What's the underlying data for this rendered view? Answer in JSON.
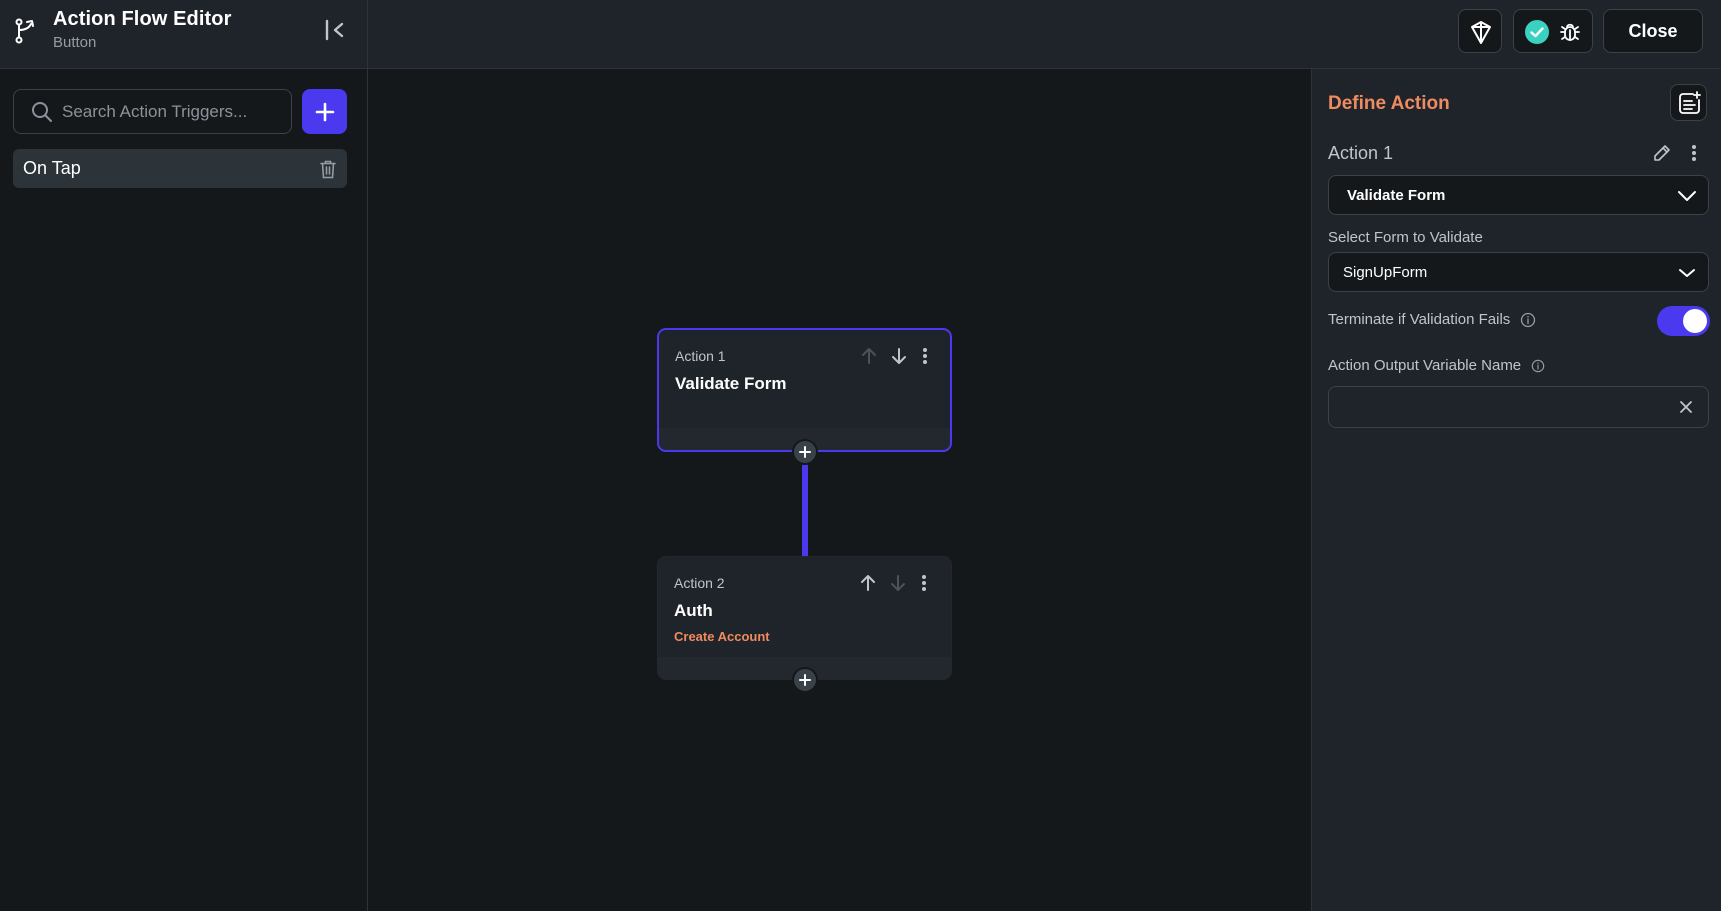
{
  "header": {
    "title": "Action Flow Editor",
    "subtitle": "Button",
    "close_label": "Close"
  },
  "sidebar": {
    "search_placeholder": "Search Action Triggers...",
    "triggers": [
      {
        "label": "On Tap"
      }
    ]
  },
  "canvas": {
    "nodes": [
      {
        "label": "Action 1",
        "title": "Validate Form",
        "subtitle": ""
      },
      {
        "label": "Action 2",
        "title": "Auth",
        "subtitle": "Create Account"
      }
    ]
  },
  "panel": {
    "title": "Define Action",
    "action_name": "Action 1",
    "action_type": "Validate Form",
    "form_label": "Select Form to Validate",
    "form_value": "SignUpForm",
    "terminate_label": "Terminate if Validation Fails",
    "terminate_enabled": true,
    "output_label": "Action Output Variable Name",
    "output_value": ""
  },
  "colors": {
    "accent": "#4b39ef",
    "secondary": "#ee8b60",
    "success": "#39d2c0",
    "background": "#14181b",
    "surface": "#1e2429"
  }
}
